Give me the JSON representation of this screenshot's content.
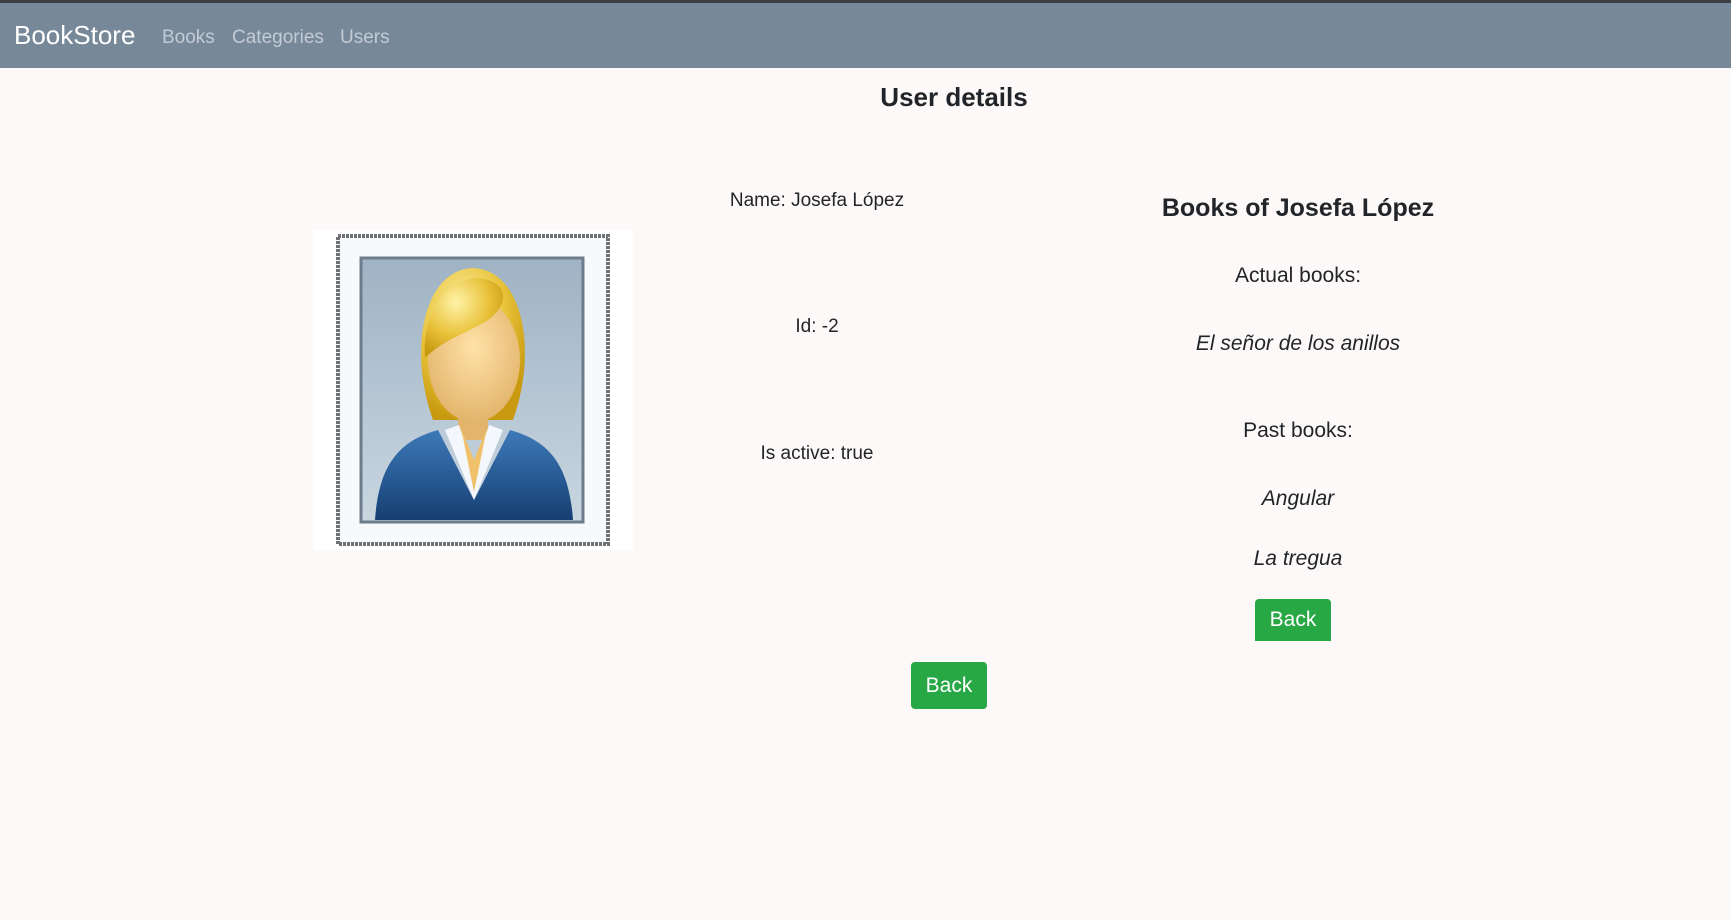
{
  "navbar": {
    "brand": "BookStore",
    "links": [
      "Books",
      "Categories",
      "Users"
    ]
  },
  "page": {
    "title": "User details"
  },
  "user": {
    "name_label": "Name: Josefa López",
    "id_label": "Id: -2",
    "active_label": "Is active: true",
    "avatar_icon": "user-portrait-icon"
  },
  "books": {
    "title": "Books of Josefa López",
    "actual_label": "Actual books:",
    "actual": [
      "El señor de los anillos"
    ],
    "past_label": "Past books:",
    "past": [
      "Angular",
      "La tregua"
    ],
    "back_label": "Back"
  },
  "footer": {
    "back_label": "Back"
  },
  "colors": {
    "navbar": "#778899",
    "button": "#28a745",
    "background": "#fdf9f8"
  }
}
